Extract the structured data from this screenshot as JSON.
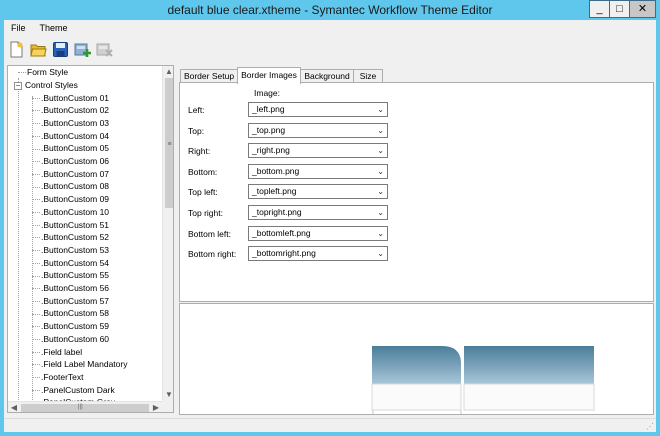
{
  "window": {
    "title": "default blue clear.xtheme - Symantec Workflow Theme Editor",
    "min_label": "_",
    "max_label": "□",
    "close_label": "✕"
  },
  "menu": [
    "File",
    "Theme"
  ],
  "toolbar": {
    "icons": [
      "new-document-icon",
      "open-folder-icon",
      "save-disk-icon",
      "add-style-icon",
      "remove-style-icon"
    ]
  },
  "tree": {
    "root_items": [
      "Form Style",
      "Control Styles"
    ],
    "expander": "−",
    "children": [
      ".ButtonCustom 01",
      ".ButtonCustom 02",
      ".ButtonCustom 03",
      ".ButtonCustom 04",
      ".ButtonCustom 05",
      ".ButtonCustom 06",
      ".ButtonCustom 07",
      ".ButtonCustom 08",
      ".ButtonCustom 09",
      ".ButtonCustom 10",
      ".ButtonCustom 51",
      ".ButtonCustom 52",
      ".ButtonCustom 53",
      ".ButtonCustom 54",
      ".ButtonCustom 55",
      ".ButtonCustom 56",
      ".ButtonCustom 57",
      ".ButtonCustom 58",
      ".ButtonCustom 59",
      ".ButtonCustom 60",
      ".Field label",
      ".Field Label Mandatory",
      ".FooterText",
      ".PanelCustom Dark",
      ".PanelCustom Gray"
    ]
  },
  "tabs": [
    "Border Setup",
    "Border Images",
    "Background",
    "Size"
  ],
  "active_tab": "Border Images",
  "border_images": {
    "column_header": "Image:",
    "fields": [
      {
        "label": "Left:",
        "value": "_left.png"
      },
      {
        "label": "Top:",
        "value": "_top.png"
      },
      {
        "label": "Right:",
        "value": "_right.png"
      },
      {
        "label": "Bottom:",
        "value": "_bottom.png"
      },
      {
        "label": "Top left:",
        "value": "_topleft.png"
      },
      {
        "label": "Top right:",
        "value": "_topright.png"
      },
      {
        "label": "Bottom left:",
        "value": "_bottomleft.png"
      },
      {
        "label": "Bottom right:",
        "value": "_bottomright.png"
      }
    ]
  },
  "colors": {
    "window_frame": "#5fc6ec",
    "preview_blue_dark": "#4a7d9a",
    "preview_blue_light": "#a9c6d8"
  }
}
